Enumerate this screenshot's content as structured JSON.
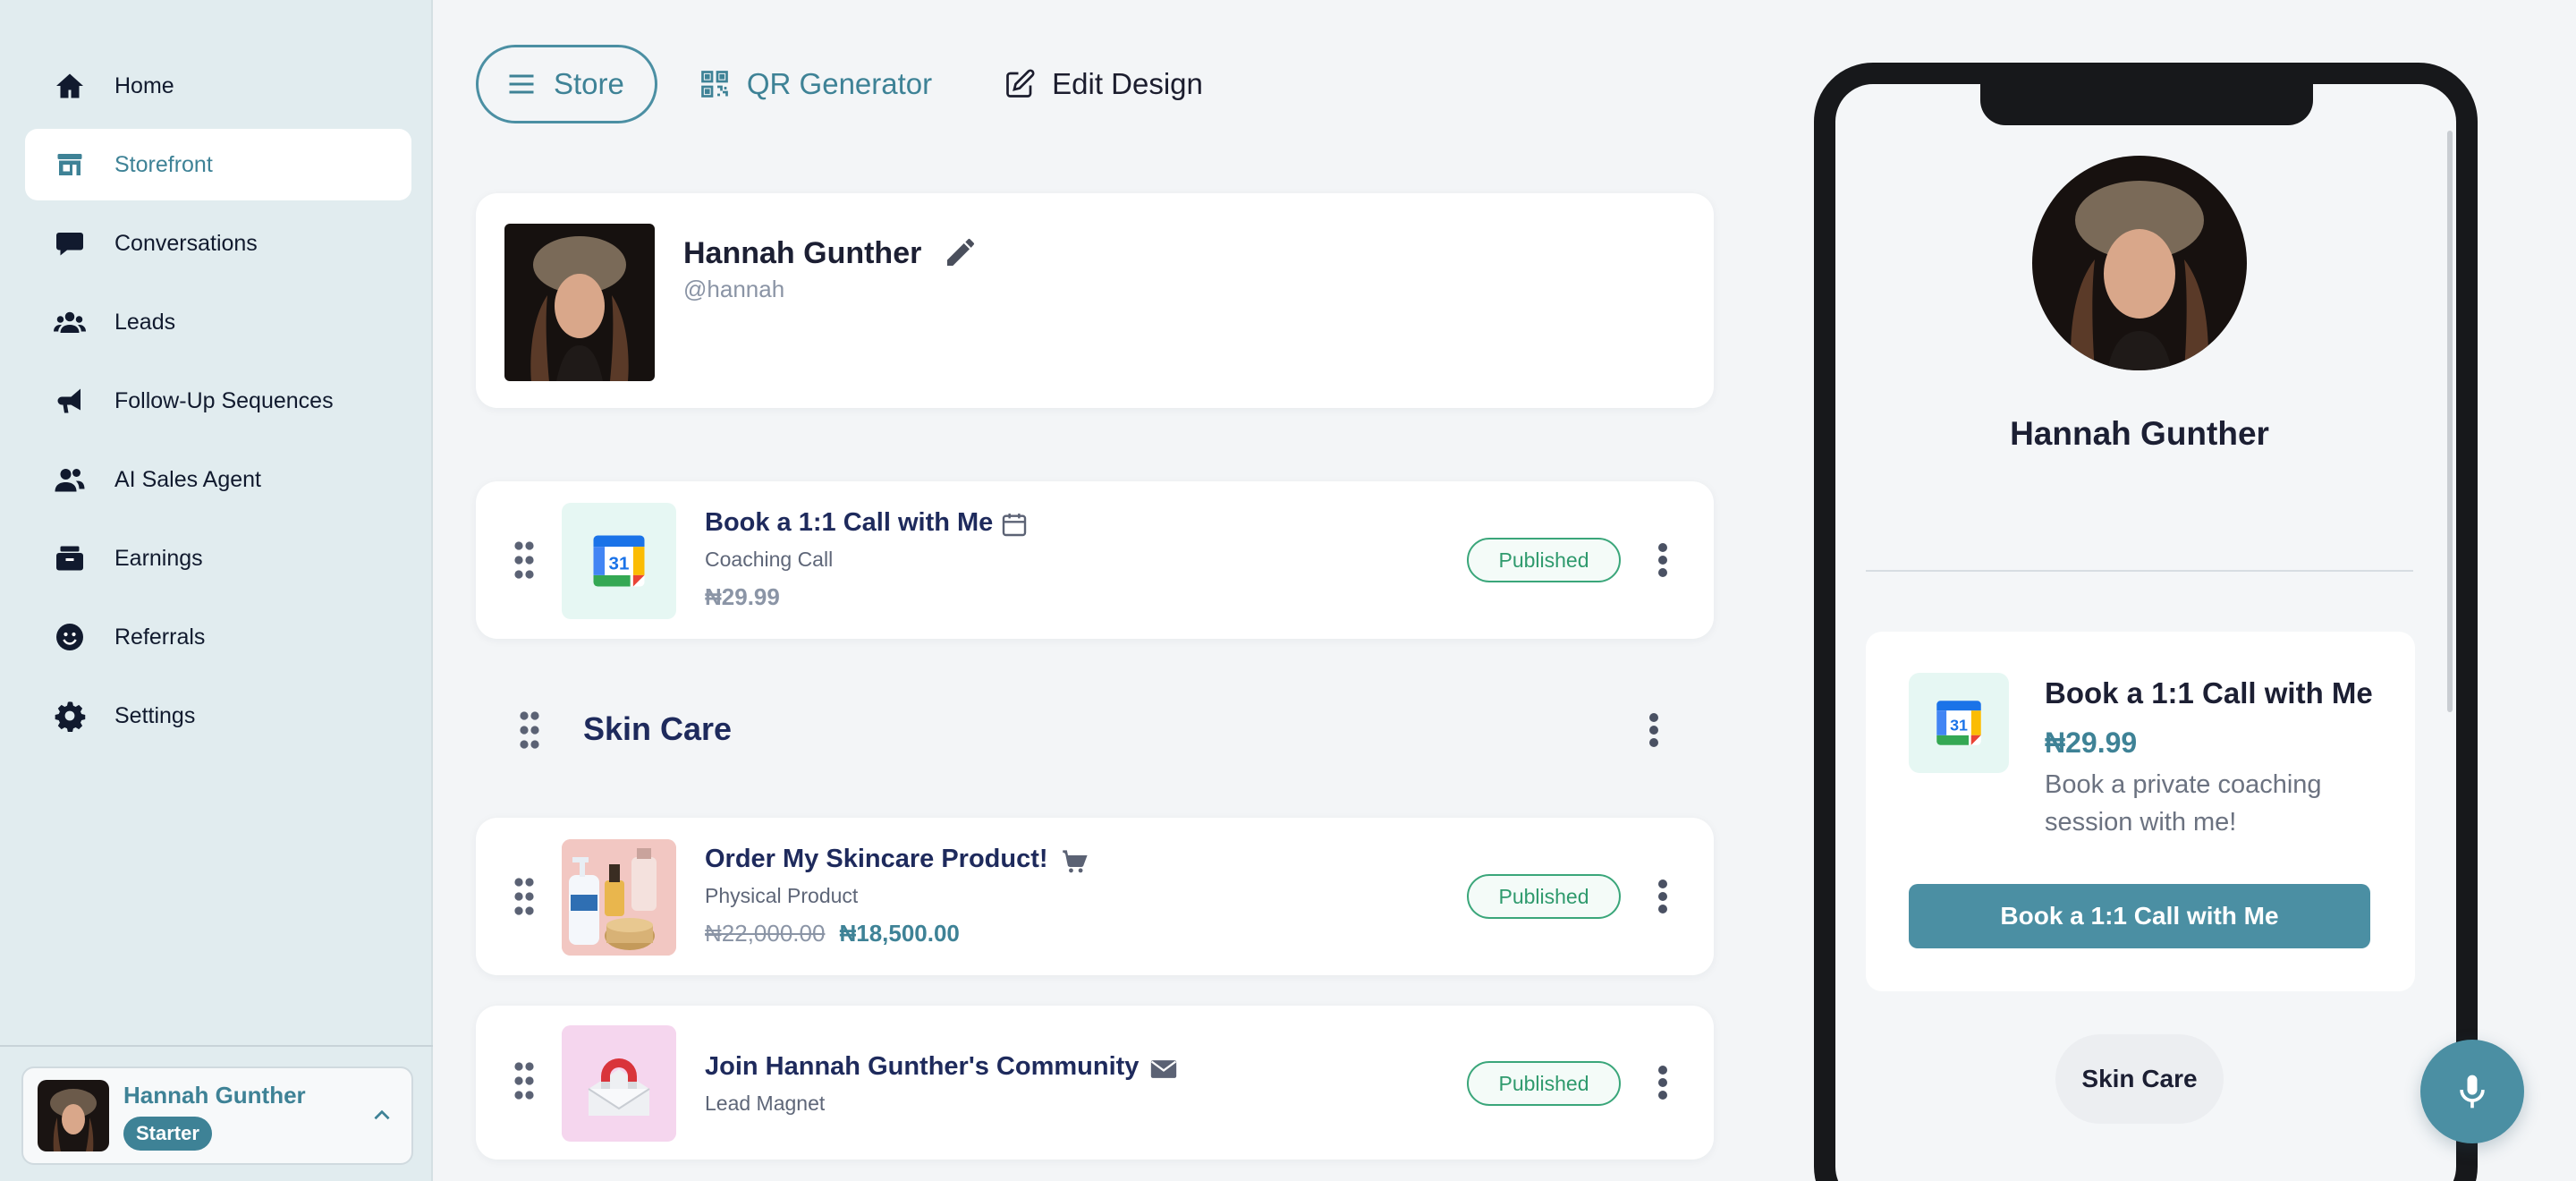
{
  "sidebar": {
    "items": [
      {
        "label": "Home",
        "icon": "home-icon"
      },
      {
        "label": "Storefront",
        "icon": "storefront-icon",
        "active": true
      },
      {
        "label": "Conversations",
        "icon": "chat-bubble-icon"
      },
      {
        "label": "Leads",
        "icon": "users-icon"
      },
      {
        "label": "Follow-Up Sequences",
        "icon": "megaphone-icon"
      },
      {
        "label": "AI Sales Agent",
        "icon": "user-group-icon"
      },
      {
        "label": "Earnings",
        "icon": "wallet-icon"
      },
      {
        "label": "Referrals",
        "icon": "smile-icon"
      },
      {
        "label": "Settings",
        "icon": "gear-icon"
      }
    ],
    "account": {
      "name": "Hannah Gunther",
      "plan": "Starter"
    }
  },
  "tabs": {
    "store": "Store",
    "qr": "QR Generator",
    "edit": "Edit Design"
  },
  "profile": {
    "name": "Hannah Gunther",
    "handle": "@hannah"
  },
  "products": [
    {
      "title": "Book a 1:1 Call with Me",
      "type": "Coaching Call",
      "price": "₦29.99",
      "status": "Published",
      "type_icon": "calendar-icon"
    },
    {
      "title": "Order My Skincare Product!",
      "type": "Physical Product",
      "old_price": "₦22,000.00",
      "price": "₦18,500.00",
      "status": "Published",
      "type_icon": "cart-icon"
    },
    {
      "title": "Join Hannah Gunther's Community",
      "type": "Lead Magnet",
      "status": "Published",
      "type_icon": "envelope-icon"
    }
  ],
  "section": {
    "title": "Skin Care"
  },
  "preview": {
    "name": "Hannah Gunther",
    "card": {
      "title": "Book a 1:1 Call with Me",
      "price": "₦29.99",
      "description": "Book a private coaching session with me!",
      "button": "Book a 1:1 Call with Me"
    },
    "section_pill": "Skin Care"
  },
  "colors": {
    "accent": "#3e8296",
    "sidebar_bg": "#e1ecef",
    "published": "#2f9a6d"
  }
}
